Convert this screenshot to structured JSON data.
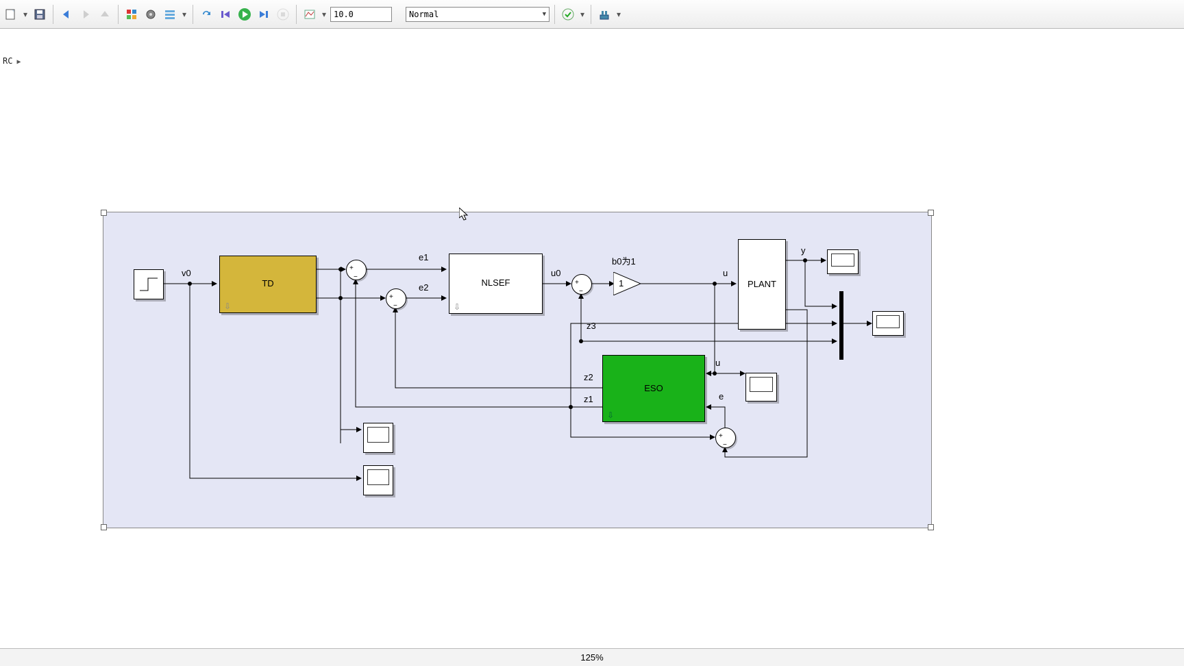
{
  "toolbar": {
    "stop_time": "10.0",
    "mode": "Normal"
  },
  "crumb": {
    "root": "RC"
  },
  "labels": {
    "v0": "v0",
    "e1": "e1",
    "e2": "e2",
    "u0": "u0",
    "u": "u",
    "u2": "u",
    "e": "e",
    "y": "y",
    "z1": "z1",
    "z2": "z2",
    "z3": "z3",
    "b0": "b0为1",
    "gain": "1"
  },
  "blocks": {
    "td": "TD",
    "nlsef": "NLSEF",
    "plant": "PLANT",
    "eso": "ESO"
  },
  "status": {
    "zoom": "125%"
  }
}
